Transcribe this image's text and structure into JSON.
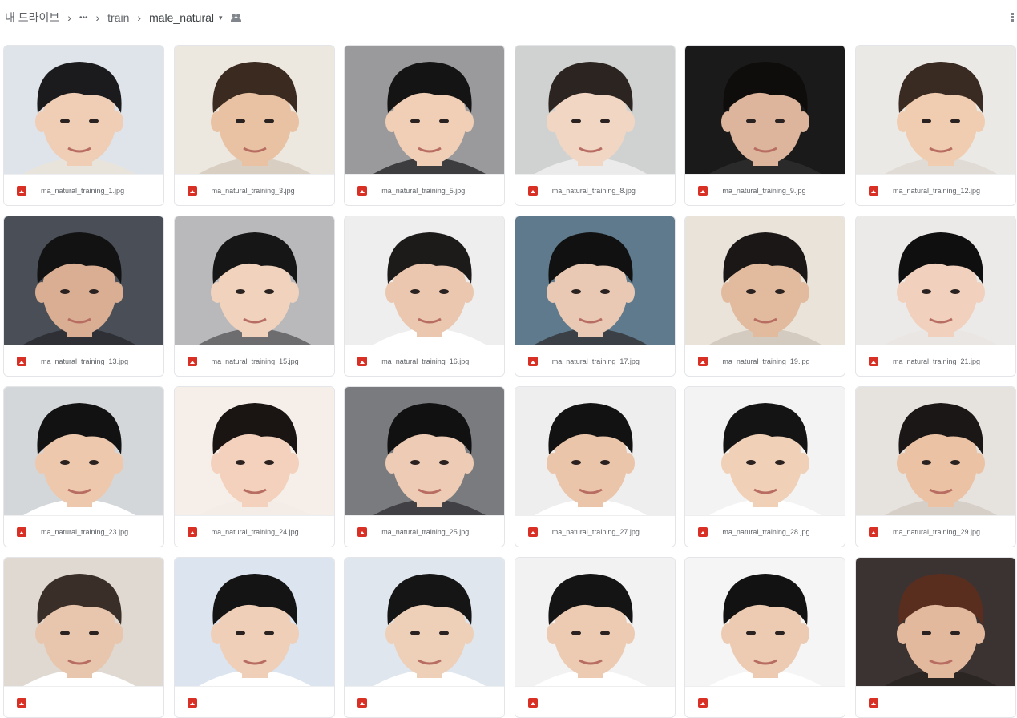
{
  "breadcrumb": {
    "root": "내 드라이브",
    "more": "•••",
    "folder": "train",
    "current": "male_natural"
  },
  "colors": {
    "file_icon": "#d93025",
    "text": "#5f6368"
  },
  "files": [
    {
      "name": "ma_natural_training_1.jpg",
      "bg": "#dfe4ea",
      "hair": "#1b1b1d",
      "skin": "#f0cdb5",
      "shirt": "#e8e4dc"
    },
    {
      "name": "ma_natural_training_3.jpg",
      "bg": "#ece7df",
      "hair": "#3a2a20",
      "skin": "#e8c2a2",
      "shirt": "#d8cfc2"
    },
    {
      "name": "ma_natural_training_5.jpg",
      "bg": "#9a9a9d",
      "hair": "#141414",
      "skin": "#f1cfb6",
      "shirt": "#3d3d40"
    },
    {
      "name": "ma_natural_training_8.jpg",
      "bg": "#cfd2d0",
      "hair": "#2b2420",
      "skin": "#f2d6c4",
      "shirt": "#ebebeb"
    },
    {
      "name": "ma_natural_training_9.jpg",
      "bg": "#1a1a1a",
      "hair": "#0f0d0c",
      "skin": "#dcb59c",
      "shirt": "#2a2a2a"
    },
    {
      "name": "ma_natural_training_12.jpg",
      "bg": "#ebe9e6",
      "hair": "#3a2b22",
      "skin": "#f0cdb0",
      "shirt": "#e0dbd4"
    },
    {
      "name": "ma_natural_training_13.jpg",
      "bg": "#4a4f57",
      "hair": "#121212",
      "skin": "#d9ae92",
      "shirt": "#2e3036"
    },
    {
      "name": "ma_natural_training_15.jpg",
      "bg": "#b9b9bb",
      "hair": "#161616",
      "skin": "#f0d2bd",
      "shirt": "#6d6d70"
    },
    {
      "name": "ma_natural_training_16.jpg",
      "bg": "#eeeeee",
      "hair": "#1d1a1a",
      "skin": "#eac7ae",
      "shirt": "#ffffff"
    },
    {
      "name": "ma_natural_training_17.jpg",
      "bg": "#5f7a8c",
      "hair": "#111111",
      "skin": "#e9c9b3",
      "shirt": "#3a4046"
    },
    {
      "name": "ma_natural_training_19.jpg",
      "bg": "#e9e3da",
      "hair": "#1a1716",
      "skin": "#e2bb9e",
      "shirt": "#d3cbc0"
    },
    {
      "name": "ma_natural_training_21.jpg",
      "bg": "#eceae8",
      "hair": "#0f0f10",
      "skin": "#f1d1bd",
      "shirt": "#e9e6e3"
    },
    {
      "name": "ma_natural_training_23.jpg",
      "bg": "#d3d7da",
      "hair": "#121212",
      "skin": "#eec8ad",
      "shirt": "#ffffff"
    },
    {
      "name": "ma_natural_training_24.jpg",
      "bg": "#f6efe9",
      "hair": "#1a1412",
      "skin": "#f3d1bc",
      "shirt": "#f4ece6"
    },
    {
      "name": "ma_natural_training_25.jpg",
      "bg": "#7a7b7f",
      "hair": "#111112",
      "skin": "#edcbb4",
      "shirt": "#404045"
    },
    {
      "name": "ma_natural_training_27.jpg",
      "bg": "#eeeeef",
      "hair": "#121212",
      "skin": "#ebc5aa",
      "shirt": "#ffffff"
    },
    {
      "name": "ma_natural_training_28.jpg",
      "bg": "#f3f3f3",
      "hair": "#141414",
      "skin": "#f0d0b6",
      "shirt": "#ffffff"
    },
    {
      "name": "ma_natural_training_29.jpg",
      "bg": "#e6e2de",
      "hair": "#1a1716",
      "skin": "#ebc2a4",
      "shirt": "#d6cfc8"
    },
    {
      "name": "",
      "bg": "#dfd9d2",
      "hair": "#3a2e28",
      "skin": "#e8c6ad",
      "shirt": "#ffffff"
    },
    {
      "name": "",
      "bg": "#dbe4ef",
      "hair": "#141414",
      "skin": "#efcfb8",
      "shirt": "#ffffff"
    },
    {
      "name": "",
      "bg": "#dfe6ee",
      "hair": "#151515",
      "skin": "#eecfb8",
      "shirt": "#ffffff"
    },
    {
      "name": "",
      "bg": "#f2f2f2",
      "hair": "#141414",
      "skin": "#eccbb2",
      "shirt": "#ffffff"
    },
    {
      "name": "",
      "bg": "#f5f5f5",
      "hair": "#121212",
      "skin": "#eccbb2",
      "shirt": "#ffffff"
    },
    {
      "name": "",
      "bg": "#3b3332",
      "hair": "#5a2e1f",
      "skin": "#e3b99e",
      "shirt": "#2b2524"
    }
  ]
}
